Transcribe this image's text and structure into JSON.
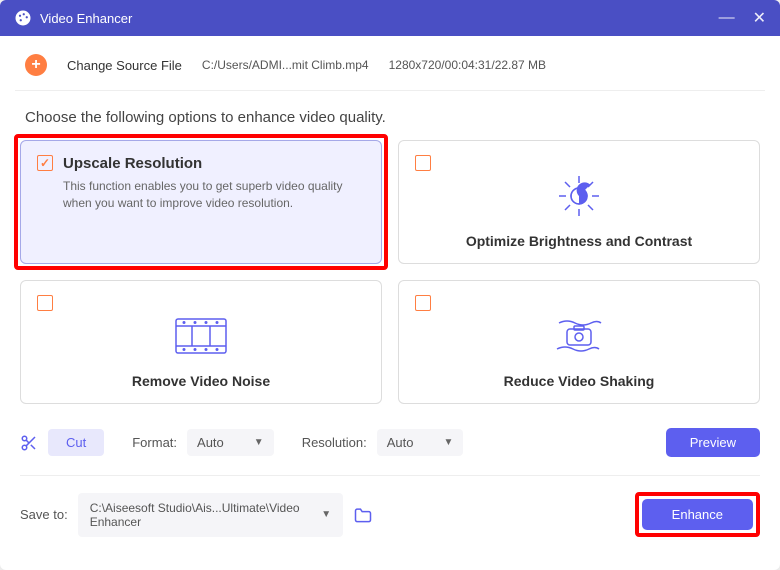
{
  "titlebar": {
    "title": "Video Enhancer"
  },
  "source": {
    "change_file_label": "Change Source File",
    "path": "C:/Users/ADMI...mit Climb.mp4",
    "meta": "1280x720/00:04:31/22.87 MB"
  },
  "prompt": "Choose the following options to enhance video quality.",
  "options": {
    "upscale": {
      "title": "Upscale Resolution",
      "desc": "This function enables you to get superb video quality when you want to improve video resolution.",
      "checked": true
    },
    "brightness": {
      "title": "Optimize Brightness and Contrast",
      "checked": false
    },
    "noise": {
      "title": "Remove Video Noise",
      "checked": false
    },
    "shaking": {
      "title": "Reduce Video Shaking",
      "checked": false
    }
  },
  "controls": {
    "cut_label": "Cut",
    "format_label": "Format:",
    "format_value": "Auto",
    "resolution_label": "Resolution:",
    "resolution_value": "Auto",
    "preview_label": "Preview"
  },
  "save": {
    "label": "Save to:",
    "path": "C:\\Aiseesoft Studio\\Ais...Ultimate\\Video Enhancer",
    "enhance_label": "Enhance"
  }
}
